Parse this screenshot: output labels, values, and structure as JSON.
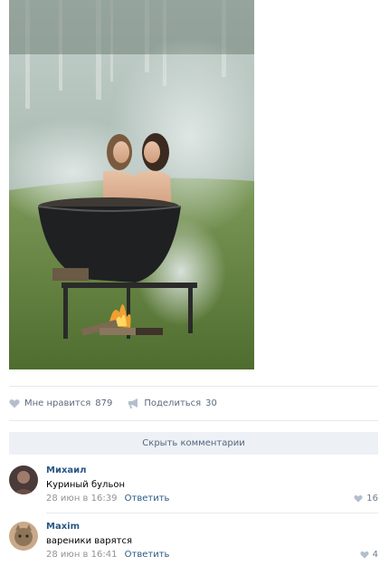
{
  "post": {
    "likes_label": "Мне нравится",
    "likes_count": "879",
    "share_label": "Поделиться",
    "share_count": "30"
  },
  "comments_toggle": "Скрыть комментарии",
  "comments": [
    {
      "author": "Михаил",
      "text": "Куриный бульон",
      "date": "28 июн в 16:39",
      "reply": "Ответить",
      "likes": "16"
    },
    {
      "author": "Maxim",
      "text": "вареники варятся",
      "date": "28 июн в 16:41",
      "reply": "Ответить",
      "likes": "4"
    }
  ],
  "colors": {
    "link": "#2a5885",
    "muted": "#939393",
    "action": "#5d6a7e",
    "toggle_bg": "#edf0f5"
  }
}
